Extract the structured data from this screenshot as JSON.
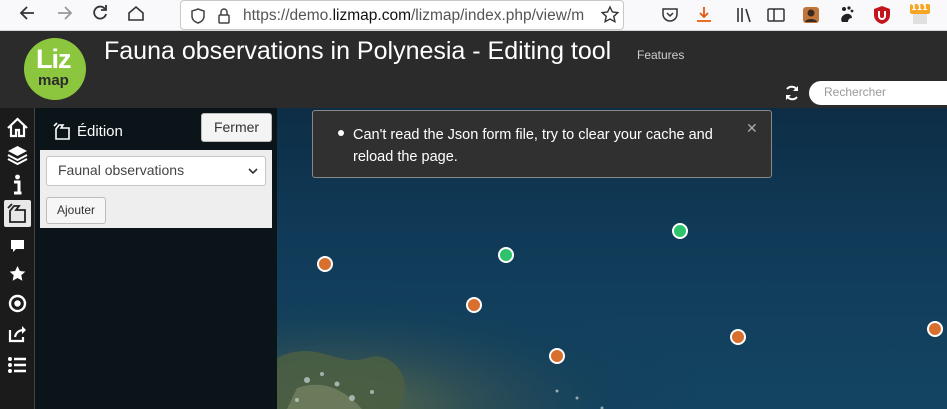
{
  "browser": {
    "url_prefix": "https://demo.",
    "url_domain": "lizmap.com",
    "url_suffix": "/lizmap/index.php/view/m",
    "extension_badge": "111"
  },
  "header": {
    "logo_top": "Liz",
    "logo_bottom": "map",
    "title": "Fauna observations in Polynesia - Editing tool",
    "subtitle": "Features",
    "search_placeholder": "Rechercher"
  },
  "menu": {
    "items": [
      "home-icon",
      "layers-icon",
      "info-icon",
      "edition-icon",
      "comment-icon",
      "star-icon",
      "locate-icon",
      "share-icon",
      "list-icon"
    ],
    "active": "edition-icon"
  },
  "dock": {
    "title": "Édition",
    "close_label": "Fermer",
    "layer_selected": "Faunal observations",
    "add_label": "Ajouter"
  },
  "notification": {
    "message": "Can't read the Json form file, try to clear your cache and reload the page."
  },
  "map": {
    "points": [
      {
        "color": "#d86f2e"
      },
      {
        "color": "#2ec26a"
      },
      {
        "color": "#2ec26a"
      },
      {
        "color": "#d86f2e"
      },
      {
        "color": "#d86f2e"
      },
      {
        "color": "#d86f2e"
      },
      {
        "color": "#d86f2e"
      }
    ]
  }
}
